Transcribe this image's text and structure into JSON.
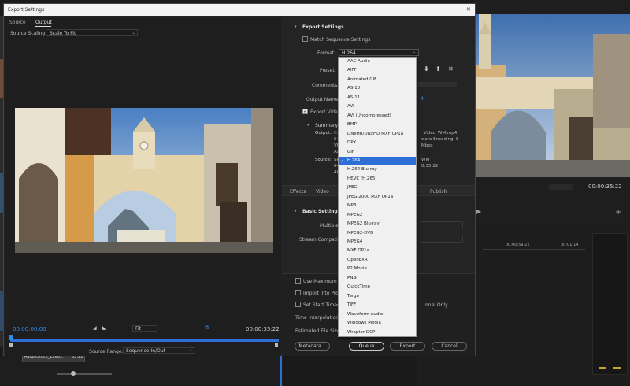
{
  "dialog": {
    "title": "Export Settings",
    "close_glyph": "✕"
  },
  "source_tabs": [
    "Source",
    "Output"
  ],
  "source_scaling": {
    "label": "Source Scaling:",
    "value": "Scale To Fit"
  },
  "timeline": {
    "current_time": "00:00:00:00",
    "fit_label": "Fit",
    "end_time": "00:00:35:22"
  },
  "source_range": {
    "label": "Source Range:",
    "value": "Sequence In/Out"
  },
  "export_settings": {
    "section_title": "Export Settings",
    "match_sequence_label": "Match Sequence Settings",
    "format_label": "Format:",
    "format_value": "H.264",
    "preset_label": "Preset:",
    "comments_label": "Comments:",
    "output_name_label": "Output Name:",
    "output_name_value": "4",
    "export_video_label": "Export Video"
  },
  "summary": {
    "title": "Summary",
    "output_label": "Output:",
    "output_lines": [
      "C:\\",
      "640",
      "Vbr",
      "AAC"
    ],
    "output_right": [
      "_Video_WM.mp4",
      "ware Encoding, 8",
      "Mbps"
    ],
    "source_label": "Source:",
    "source_lines": [
      "Seq",
      "640",
      "480"
    ],
    "source_right": [
      "WM",
      "0:35:22"
    ]
  },
  "tabs": {
    "effects": "Effects",
    "video": "Video",
    "publish": "Publish"
  },
  "basic_settings": {
    "title": "Basic Settings",
    "multiplexer_label": "Multiplex",
    "stream_label": "Stream Compatibilit"
  },
  "options": {
    "max_render": "Use Maximum Ren",
    "import_project": "Import Into Project",
    "start_timecode": "Set Start Timecode",
    "render_alpha": "nnel Only",
    "time_interp_label": "Time Interpolation:",
    "time_interp_value": "Fr",
    "est_size_label": "Estimated File Size:",
    "est_size_value": "4"
  },
  "buttons": {
    "metadata": "Metadata...",
    "queue": "Queue",
    "export": "Export",
    "cancel": "Cancel"
  },
  "format_options": [
    "AAC Audio",
    "AIFF",
    "Animated GIF",
    "AS-10",
    "AS-11",
    "AVI",
    "AVI (Uncompressed)",
    "BMP",
    "DNxHR/DNxHD MXF OP1a",
    "DPX",
    "GIF",
    "H.264",
    "H.264 Blu-ray",
    "HEVC (H.265)",
    "JPEG",
    "JPEG 2000 MXF OP1a",
    "MP3",
    "MPEG2",
    "MPEG2 Blu-ray",
    "MPEG2-DVD",
    "MPEG4",
    "MXF OP1a",
    "OpenEXR",
    "P2 Movie",
    "PNG",
    "QuickTime",
    "Targa",
    "TIFF",
    "Waveform Audio",
    "Windows Media",
    "Wrapter DCP"
  ],
  "selected_format": "H.264",
  "check_glyph": "✓",
  "background": {
    "monitor_time": "00:00:35:22",
    "ruler_left": "00:00:59:22",
    "ruler_right": "00:01:14",
    "clip_name": "AdobeStock_1266...",
    "clip_time": "35:22"
  },
  "colors": {
    "accent": "#2d8ceb",
    "selection": "#2d6fd6",
    "dialog_bg": "#232323",
    "panel_bg": "#1e1e1e"
  }
}
